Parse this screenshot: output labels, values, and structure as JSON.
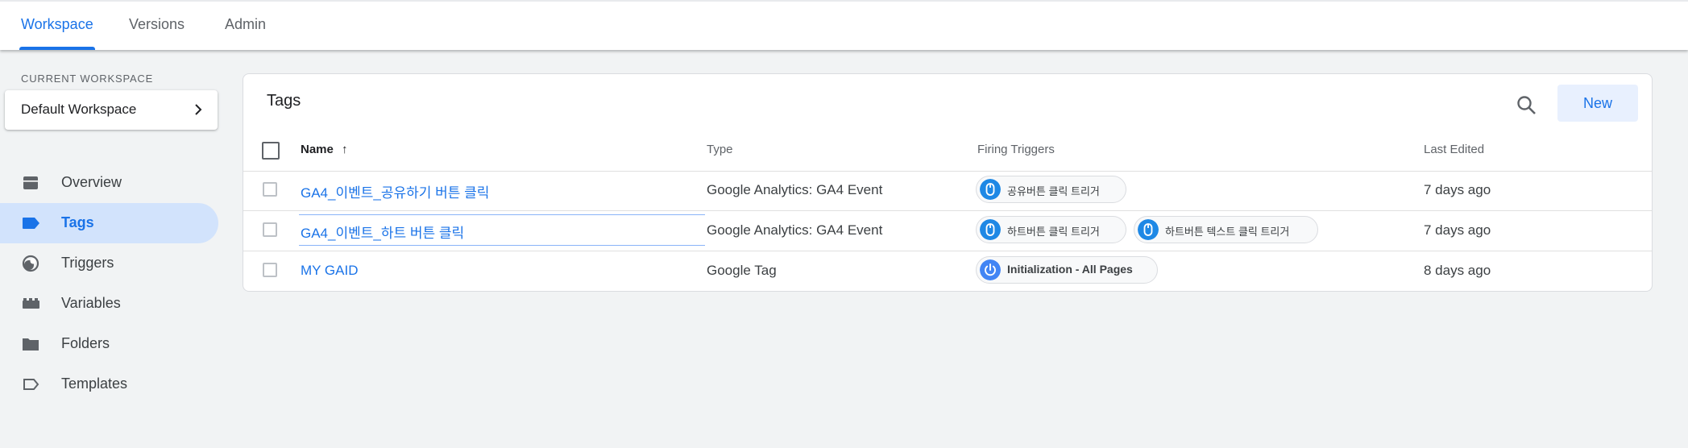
{
  "colors": {
    "accent": "#1a73e8",
    "active_nav_bg": "#d2e3fc",
    "trigger_click": "#1e88e5",
    "trigger_init": "#4285f4"
  },
  "topnav": {
    "tabs": [
      {
        "label": "Workspace",
        "active": true
      },
      {
        "label": "Versions",
        "active": false
      },
      {
        "label": "Admin",
        "active": false
      }
    ]
  },
  "sidebar": {
    "workspace_label": "CURRENT WORKSPACE",
    "workspace_name": "Default Workspace",
    "items": [
      {
        "label": "Overview",
        "icon": "inbox-icon"
      },
      {
        "label": "Tags",
        "icon": "tag-icon",
        "active": true
      },
      {
        "label": "Triggers",
        "icon": "trigger-icon"
      },
      {
        "label": "Variables",
        "icon": "variables-icon"
      },
      {
        "label": "Folders",
        "icon": "folder-icon"
      },
      {
        "label": "Templates",
        "icon": "template-icon"
      }
    ]
  },
  "main": {
    "title": "Tags",
    "new_button": "New",
    "columns": {
      "name": "Name",
      "sort_arrow": "↑",
      "type": "Type",
      "triggers": "Firing Triggers",
      "edited": "Last Edited"
    },
    "rows": [
      {
        "name": "GA4_이벤트_공유하기 버튼 클릭",
        "type": "Google Analytics: GA4 Event",
        "triggers": [
          {
            "label": "공유버튼 클릭 트리거",
            "icon": "click-trigger-icon"
          }
        ],
        "edited": "7 days ago"
      },
      {
        "name": "GA4_이벤트_하트 버튼 클릭",
        "type": "Google Analytics: GA4 Event",
        "triggers": [
          {
            "label": "하트버튼 클릭 트리거",
            "icon": "click-trigger-icon"
          },
          {
            "label": "하트버튼 텍스트 클릭 트리거",
            "icon": "click-trigger-icon"
          }
        ],
        "edited": "7 days ago"
      },
      {
        "name": "MY GAID",
        "type": "Google Tag",
        "triggers": [
          {
            "label": "Initialization - All Pages",
            "icon": "power-icon"
          }
        ],
        "edited": "8 days ago"
      }
    ]
  }
}
